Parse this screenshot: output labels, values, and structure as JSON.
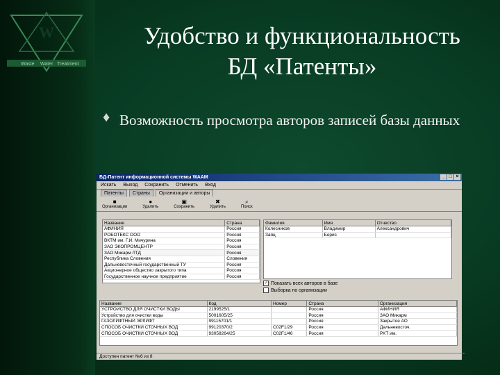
{
  "slide": {
    "title_line1": "Удобство и функциональность",
    "title_line2": "БД «Патенты»",
    "bullet_glyph": "♦",
    "bullet_text": "Возможность просмотра авторов записей базы данных",
    "logo_text_1": "Waste",
    "logo_text_2": "Water",
    "logo_text_3": "Treatment"
  },
  "app": {
    "title": "БД-Патент информационной системы WAAM",
    "menu": [
      "Искать",
      "Выход",
      "Сохранить",
      "Отменить",
      "Вход"
    ],
    "tabs": [
      "Патенты",
      "Страны",
      "Организации и авторы"
    ],
    "tools": [
      "Организации",
      "Удалить",
      "Сохранить",
      "Удалить",
      "Поиск"
    ],
    "orgs": {
      "headers": [
        "Название",
        "Страна"
      ],
      "rows": [
        [
          "АФИНИЯ",
          "Россия"
        ],
        [
          "РОБОТЕКС ООО",
          "Россия"
        ],
        [
          "ВКТМ им. Г.И. Мичурина",
          "Россия"
        ],
        [
          "ЗАО ЭКОПРОМЦЕНТР",
          "Россия"
        ],
        [
          "ЗАО Микарм ЛТД",
          "Россия"
        ],
        [
          "Республика Словения",
          "Словения"
        ],
        [
          "Дальневосточный государственный ТУ",
          "Россия"
        ],
        [
          "Акционерное общество закрытого типа",
          "Россия"
        ],
        [
          "Государственное научное предприятие",
          "Россия"
        ]
      ]
    },
    "authors": {
      "headers": [
        "Фамилия",
        "Имя",
        "Отчество"
      ],
      "rows": [
        [
          "Колесников",
          "Владимир",
          "Александрович"
        ],
        [
          "Заяц",
          "Борис",
          ""
        ]
      ]
    },
    "checkbox_show_all": "Показать всех авторов в базе",
    "checkbox_filter": "Выборка по организации",
    "patents": {
      "headers": [
        "Название",
        "Код",
        "Номер",
        "Страна",
        "Организация"
      ],
      "rows": [
        [
          "УСТРОЙСТВО ДЛЯ ОЧИСТКИ ВОДЫ",
          "2199525/1",
          "",
          "Россия",
          "АФИНИЯ"
        ],
        [
          "Устройство для очистки воды",
          "5001605/25",
          "",
          "Россия",
          "ЗАО Микарм"
        ],
        [
          "ГАЗОЛИФТНЫЙ ЭРЛИФТ",
          "99115701/1",
          "",
          "Россия",
          "Закрытое АО"
        ],
        [
          "СПОСОБ ОЧИСТКИ СТОЧНЫХ ВОД",
          "99120370/2",
          "C02F1/29",
          "Россия",
          "Дальневосточ."
        ],
        [
          "СПОСОБ ОЧИСТКИ СТОЧНЫХ ВОД",
          "93058264/25",
          "C02F1/46",
          "Россия",
          "РХТ им."
        ]
      ]
    },
    "status_text": "Доступен патент №6 из 8"
  }
}
